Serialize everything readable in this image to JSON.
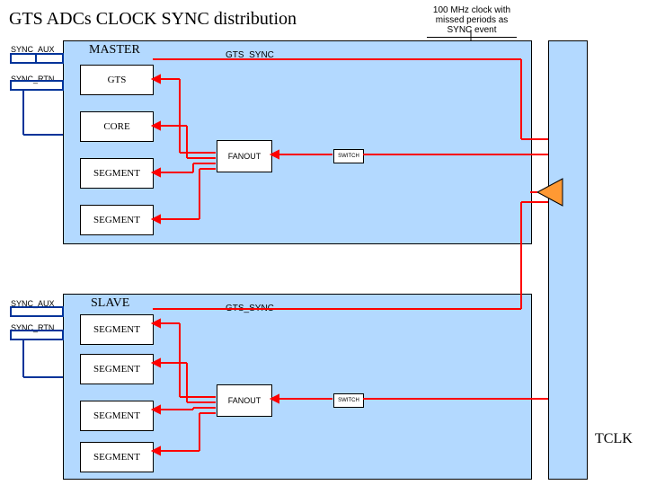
{
  "title": "GTS ADCs CLOCK SYNC distribution",
  "callout": "100 MHz clock with missed periods as SYNC event",
  "master": {
    "title": "MASTER",
    "gts_sync": "GTS_SYNC",
    "boxes": [
      "GTS",
      "CORE",
      "SEGMENT",
      "SEGMENT"
    ],
    "fanout": "FANOUT",
    "switch": "SWITCH"
  },
  "slave": {
    "title": "SLAVE",
    "gts_sync": "GTS_SYNC",
    "boxes": [
      "SEGMENT",
      "SEGMENT",
      "SEGMENT",
      "SEGMENT"
    ],
    "fanout": "FANOUT",
    "switch": "SWITCH"
  },
  "side_labels": {
    "sync_aux": "SYNC_AUX",
    "sync_rtn": "SYNC_RTN"
  },
  "tclk": "TCLK"
}
